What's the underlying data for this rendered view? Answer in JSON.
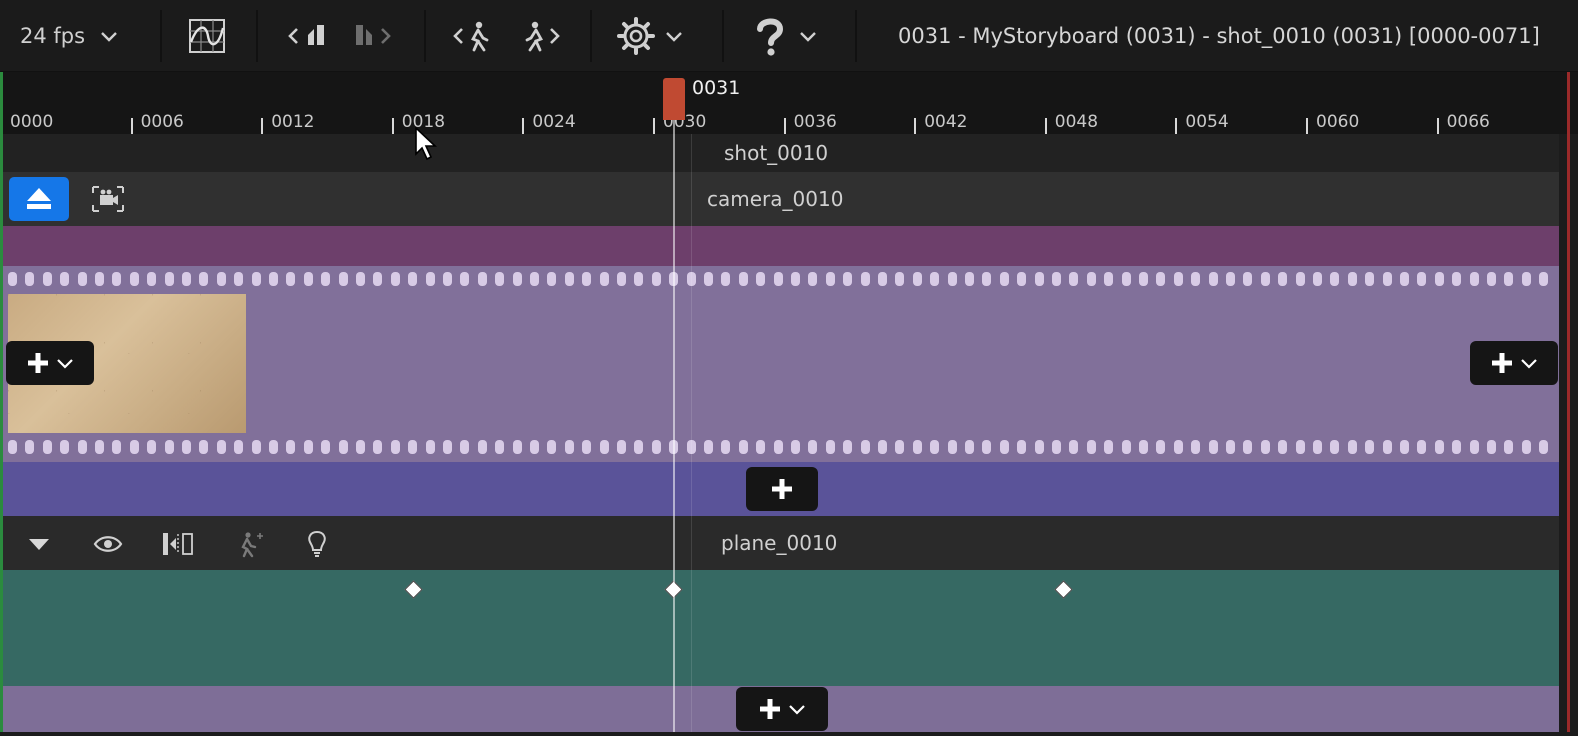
{
  "toolbar": {
    "fps_label": "24 fps",
    "title": "0031 - MyStoryboard (0031) - shot_0010 (0031) [0000-0071]",
    "icons": [
      "curve-editor-icon",
      "prev-key-icon",
      "next-key-icon",
      "step-back-icon",
      "step-forward-icon",
      "settings-icon",
      "help-icon"
    ]
  },
  "ruler": {
    "ticks": [
      "0000",
      "0006",
      "0012",
      "0018",
      "0024",
      "0030",
      "0036",
      "0042",
      "0048",
      "0054",
      "0060",
      "0066"
    ],
    "current_frame": "0031"
  },
  "tracks": {
    "shot_name": "shot_0010",
    "camera_name": "camera_0010",
    "plane_name": "plane_0010"
  },
  "colors": {
    "accent_blue": "#1577e8",
    "playhead": "#c04a32",
    "magenta_track": "#6d3f6b",
    "film_track": "#81709a",
    "blue_track": "#5a5399",
    "teal_track": "#366963"
  }
}
